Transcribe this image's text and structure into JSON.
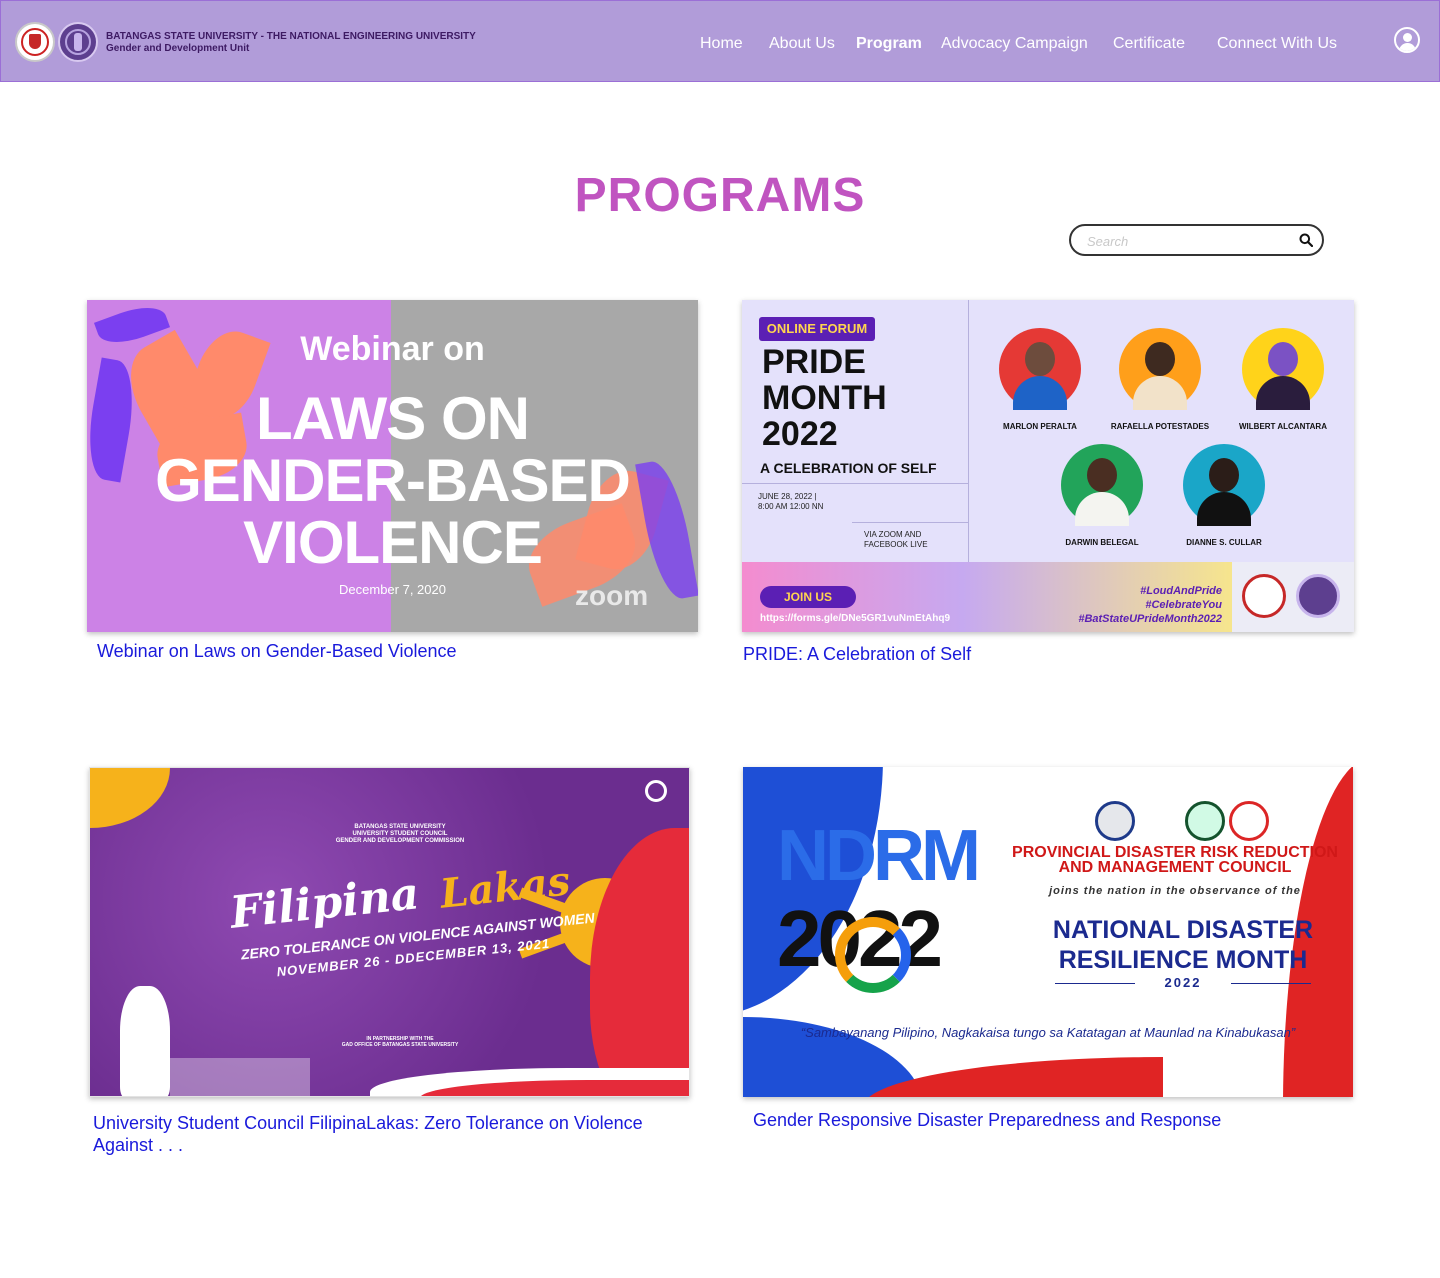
{
  "colors": {
    "nav_bg": "#b19cd9",
    "title": "#c054c0",
    "link": "#1a1adb"
  },
  "header": {
    "university": "BATANGAS STATE UNIVERSITY - THE NATIONAL ENGINEERING UNIVERSITY",
    "unit": "Gender and Development Unit",
    "menu": [
      {
        "label": "Home",
        "active": false
      },
      {
        "label": "About Us",
        "active": false
      },
      {
        "label": "Program",
        "active": true
      },
      {
        "label": "Advocacy Campaign",
        "active": false
      },
      {
        "label": "Certificate",
        "active": false
      },
      {
        "label": "Connect With Us",
        "active": false
      }
    ],
    "user_icon": "user-icon"
  },
  "page": {
    "title": "PROGRAMS",
    "search_placeholder": "Search",
    "search_icon": "search-icon"
  },
  "programs": [
    {
      "caption": "Webinar on Laws on Gender-Based Violence",
      "image": {
        "line1": "Webinar on",
        "line2": "LAWS ON",
        "line3": "GENDER-BASED",
        "line4": "VIOLENCE",
        "date": "December 7, 2020",
        "platform": "zoom"
      }
    },
    {
      "caption": "PRIDE: A Celebration of Self",
      "image": {
        "badge": "ONLINE FORUM",
        "line1": "PRIDE",
        "line2": "MONTH",
        "line3": "2022",
        "subtitle": "A CELEBRATION OF SELF",
        "date1": "JUNE 28, 2022 |",
        "date2": "8:00 AM 12:00 NN",
        "via1": "VIA ZOOM  AND",
        "via2": "FACEBOOK LIVE",
        "speakers": [
          "MARLON PERALTA",
          "RAFAELLA POTESTADES",
          "WILBERT ALCANTARA",
          "DARWIN BELEGAL",
          "DIANNE S. CULLAR"
        ],
        "join": "JOIN US",
        "url": "https://forms.gle/DNe5GR1vuNmEtAhq9",
        "tag1": "#LoudAndPride",
        "tag2": "#CelebrateYou",
        "tag3": "#BatStateUPrideMonth2022"
      }
    },
    {
      "caption": "University Student Council FilipinaLakas: Zero Tolerance on Violence Against . . .",
      "image": {
        "org1": "BATANGAS STATE UNIVERSITY",
        "org2": "UNIVERSITY STUDENT COUNCIL",
        "org3": "GENDER AND DEVELOPMENT COMMISSION",
        "title_a": "Filipina",
        "title_b": "Lakas",
        "tagline": "ZERO TOLERANCE ON VIOLENCE AGAINST WOMEN",
        "dates": "NOVEMBER  26 - DDECEMBER 13, 2021",
        "partner1": "IN PARTNERSHIP WITH THE",
        "partner2": "GAD OFFICE OF BATANGAS STATE UNIVERSITY"
      }
    },
    {
      "caption": "Gender Responsive Disaster Preparedness and Response",
      "image": {
        "logo_text": "NDRM",
        "logo_year": "2022",
        "org1": "PROVINCIAL DISASTER RISK REDUCTION",
        "org2": "AND MANAGEMENT COUNCIL",
        "joins": "joins the nation in the observance of the",
        "event1": "NATIONAL DISASTER",
        "event2": "RESILIENCE MONTH",
        "year": "2022",
        "quote": "“Sambayanang Pilipino, Nagkakaisa tungo sa Katatagan at Maunlad na Kinabukasan”"
      }
    }
  ]
}
